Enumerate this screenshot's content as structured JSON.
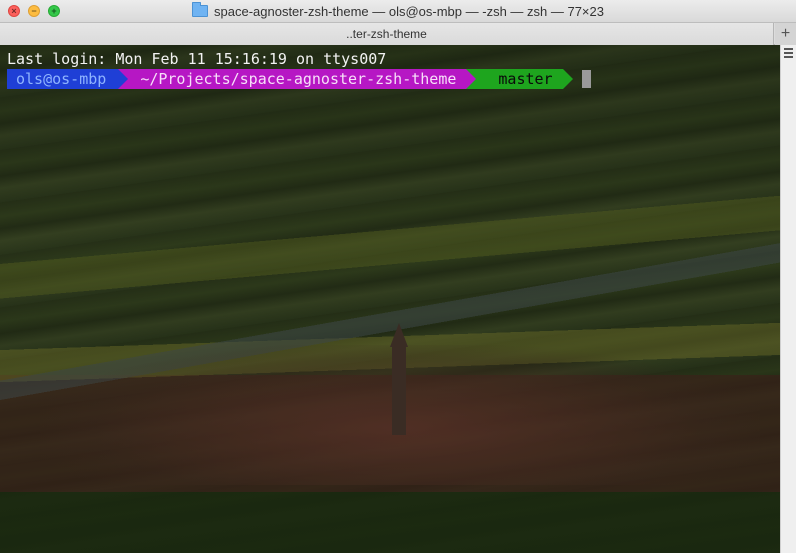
{
  "window": {
    "title": "space-agnoster-zsh-theme — ols@os-mbp — -zsh — zsh — 77×23"
  },
  "traffic_lights": {
    "close_glyph": "×",
    "minimize_glyph": "−",
    "maximize_glyph": "+"
  },
  "tabs": [
    {
      "label": "..ter-zsh-theme",
      "active": true
    }
  ],
  "tab_add_label": "+",
  "terminal": {
    "last_login": "Last login: Mon Feb 11 15:16:19 on ttys007",
    "prompt": {
      "user_host": "ols@os-mbp",
      "cwd": "~/Projects/space-agnoster-zsh-theme",
      "branch_icon": "",
      "branch": "master"
    }
  },
  "colors": {
    "user_segment": "#1f3fd6",
    "dir_segment": "#b617c4",
    "git_segment": "#1ea51e"
  },
  "icons": {
    "folder": "folder-icon",
    "git_branch": "git-branch-icon"
  }
}
